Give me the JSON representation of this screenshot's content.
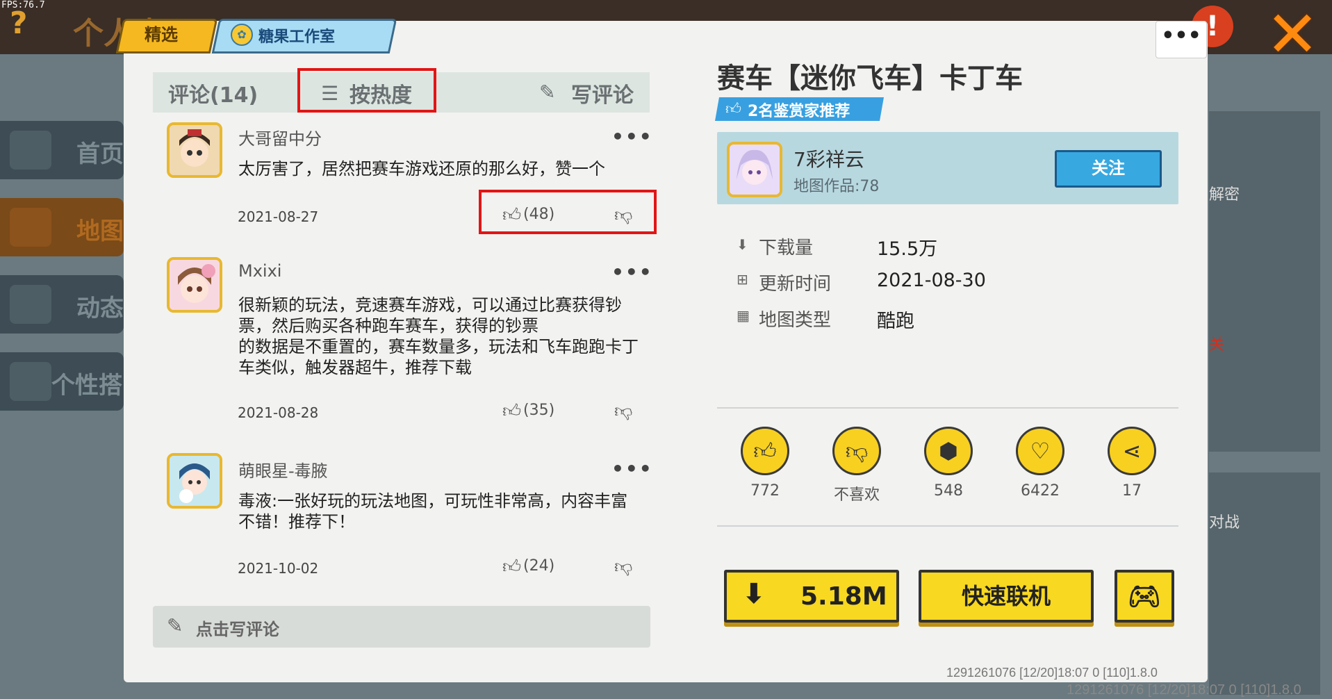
{
  "fps": "FPS:76.7",
  "background": {
    "top_title": "个人中心",
    "sidebar": [
      {
        "label": "首页"
      },
      {
        "label": "地图"
      },
      {
        "label": "动态"
      },
      {
        "label": "个性搭"
      }
    ],
    "right_labels": [
      "解密",
      "关",
      "对战"
    ],
    "footer_id": "1291261076   [12/20]18:07 0  [110]1.8.0"
  },
  "tabs": [
    {
      "label": "精选"
    },
    {
      "label": "糖果工作室"
    }
  ],
  "menu_dots": "•••",
  "comments": {
    "count_label": "评论(14)",
    "sort_label": "按热度",
    "write_label": "写评论",
    "write_bar_label": "点击写评论",
    "items": [
      {
        "user": "大哥留中分",
        "text": "太厉害了，居然把赛车游戏还原的那么好，赞一个",
        "date": "2021-08-27",
        "likes": "(48)"
      },
      {
        "user": "Mxixi",
        "text": "很新颖的玩法，竞速赛车游戏，可以通过比赛获得钞票，然后购买各种跑车赛车，获得的钞票\n的数据是不重置的，赛车数量多，玩法和飞车跑跑卡丁车类似，触发器超牛，推荐下载",
        "date": "2021-08-28",
        "likes": "(35)"
      },
      {
        "user": "萌眼星-毒腋",
        "text": "毒液:一张好玩的玩法地图，可玩性非常高，内容丰富不错！推荐下！",
        "date": "2021-10-02",
        "likes": "(24)"
      }
    ]
  },
  "map": {
    "title": "赛车【迷你飞车】卡丁车",
    "recommend": "2名鉴赏家推荐",
    "author": {
      "name": "7彩祥云",
      "works": "地图作品:78",
      "follow_label": "关注"
    },
    "stats": [
      {
        "label": "下载量",
        "value": "15.5万",
        "icon": "download-icon"
      },
      {
        "label": "更新时间",
        "value": "2021-08-30",
        "icon": "plus-box-icon"
      },
      {
        "label": "地图类型",
        "value": "酷跑",
        "icon": "grid-icon"
      }
    ],
    "actions": [
      {
        "name": "like",
        "value": "772",
        "icon": "thumbs-up-icon"
      },
      {
        "name": "dislike",
        "value": "不喜欢",
        "icon": "thumbs-down-icon"
      },
      {
        "name": "collect",
        "value": "548",
        "icon": "box-icon"
      },
      {
        "name": "favorite",
        "value": "6422",
        "icon": "heart-icon"
      },
      {
        "name": "share",
        "value": "17",
        "icon": "share-icon"
      }
    ],
    "download_size": "5.18M",
    "quick_online": "快速联机",
    "version": "1291261076    [12/20]18:07 0   [110]1.8.0"
  },
  "colors": {
    "accent_yellow": "#f8d820",
    "follow_blue": "#38a8e0",
    "highlight_red": "#e21515"
  }
}
